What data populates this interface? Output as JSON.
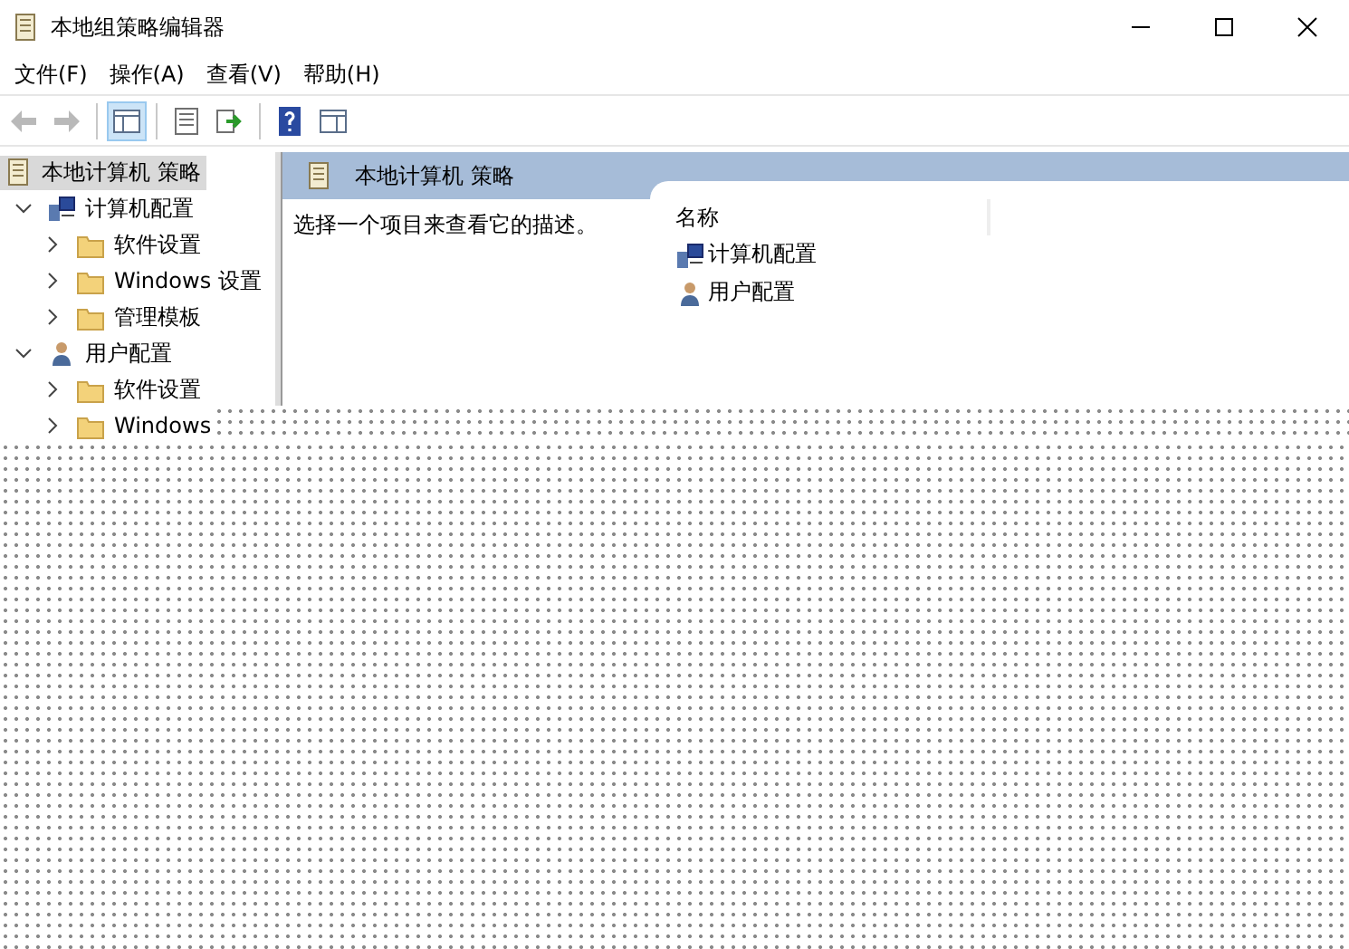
{
  "window": {
    "title": "本地组策略编辑器"
  },
  "menu": [
    "文件(F)",
    "操作(A)",
    "查看(V)",
    "帮助(H)"
  ],
  "toolbar": [
    [
      {
        "kind": "back",
        "disabled": true,
        "pressed": false
      },
      {
        "kind": "forward",
        "disabled": true,
        "pressed": false
      }
    ],
    [
      {
        "kind": "tree",
        "disabled": false,
        "pressed": true
      }
    ],
    [
      {
        "kind": "list",
        "disabled": false,
        "pressed": false
      },
      {
        "kind": "export",
        "disabled": false,
        "pressed": false
      }
    ],
    [
      {
        "kind": "help",
        "disabled": false,
        "pressed": false
      },
      {
        "kind": "pane",
        "disabled": false,
        "pressed": false
      }
    ]
  ],
  "tree": [
    {
      "label": "本地计算机 策略",
      "kind": "policy",
      "selected": true,
      "children": [
        {
          "label": "计算机配置",
          "kind": "computer",
          "selected": false,
          "expanded": true,
          "children": [
            {
              "label": "软件设置",
              "kind": "folder",
              "selected": false,
              "expanded": false
            },
            {
              "label": "Windows 设置",
              "kind": "folder",
              "selected": false,
              "expanded": false
            },
            {
              "label": "管理模板",
              "kind": "folder",
              "selected": false,
              "expanded": false
            }
          ]
        },
        {
          "label": "用户配置",
          "kind": "user",
          "selected": false,
          "expanded": true,
          "children": [
            {
              "label": "软件设置",
              "kind": "folder",
              "selected": false,
              "expanded": false
            },
            {
              "label": "Windows",
              "kind": "folder",
              "selected": false,
              "expanded": false
            }
          ]
        }
      ]
    }
  ],
  "detail": {
    "title": "本地计算机 策略",
    "description": "选择一个项目来查看它的描述。",
    "column": "名称",
    "items": [
      {
        "label": "计算机配置",
        "kind": "computer"
      },
      {
        "label": "用户配置",
        "kind": "user"
      }
    ]
  }
}
